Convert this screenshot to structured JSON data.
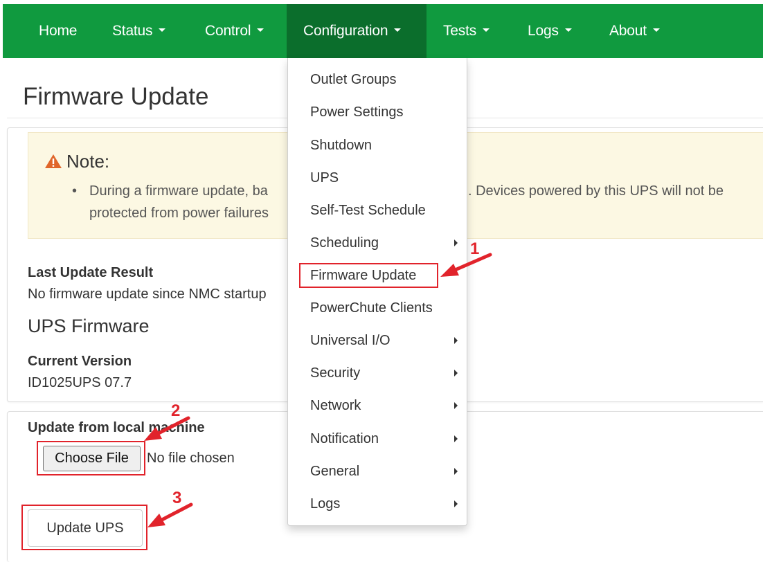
{
  "nav": {
    "items": [
      {
        "label": "Home",
        "caret": false
      },
      {
        "label": "Status",
        "caret": true
      },
      {
        "label": "Control",
        "caret": true
      },
      {
        "label": "Configuration",
        "caret": true,
        "active": true
      },
      {
        "label": "Tests",
        "caret": true
      },
      {
        "label": "Logs",
        "caret": true
      },
      {
        "label": "About",
        "caret": true
      }
    ],
    "bar_color": "#109a3f",
    "active_color": "#0b6e2c"
  },
  "page": {
    "title": "Firmware Update"
  },
  "note": {
    "title": "Note:",
    "icon": "warning-triangle-icon",
    "text_left_line1": "During a firmware update, ba",
    "text_right_line1": ". Devices powered by this UPS will not be",
    "text_left_line2": "protected from power failures"
  },
  "last_update": {
    "label": "Last Update Result",
    "value": "No firmware update since NMC startup"
  },
  "ups_firmware": {
    "heading": "UPS Firmware",
    "version_label": "Current Version",
    "version_value": "ID1025UPS 07.7"
  },
  "upload": {
    "label": "Update from local machine",
    "choose_file": "Choose File",
    "no_file": "No file chosen",
    "update_button": "Update UPS"
  },
  "dropdown": {
    "items": [
      {
        "label": "Outlet Groups",
        "submenu": false
      },
      {
        "label": "Power Settings",
        "submenu": false
      },
      {
        "label": "Shutdown",
        "submenu": false
      },
      {
        "label": "UPS",
        "submenu": false
      },
      {
        "label": "Self-Test Schedule",
        "submenu": false
      },
      {
        "label": "Scheduling",
        "submenu": true
      },
      {
        "label": "Firmware Update",
        "submenu": false,
        "highlighted": true
      },
      {
        "label": "PowerChute Clients",
        "submenu": false
      },
      {
        "label": "Universal I/O",
        "submenu": true
      },
      {
        "label": "Security",
        "submenu": true
      },
      {
        "label": "Network",
        "submenu": true
      },
      {
        "label": "Notification",
        "submenu": true
      },
      {
        "label": "General",
        "submenu": true
      },
      {
        "label": "Logs",
        "submenu": true
      }
    ]
  },
  "annotations": {
    "steps": [
      "1",
      "2",
      "3"
    ],
    "color": "#e1232b"
  }
}
